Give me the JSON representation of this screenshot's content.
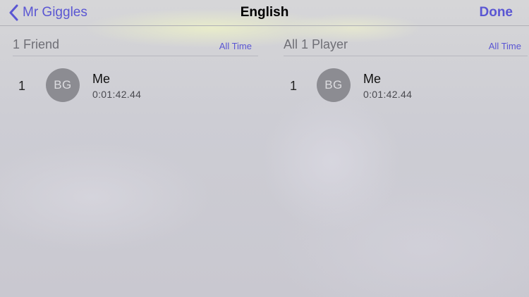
{
  "navbar": {
    "back_label": "Mr Giggles",
    "title": "English",
    "done_label": "Done"
  },
  "friends_panel": {
    "title": "1 Friend",
    "scope": "All Time",
    "entries": [
      {
        "rank": "1",
        "avatar_initials": "BG",
        "name": "Me",
        "score": "0:01:42.44"
      }
    ]
  },
  "players_panel": {
    "title": "All 1 Player",
    "scope": "All Time",
    "entries": [
      {
        "rank": "1",
        "avatar_initials": "BG",
        "name": "Me",
        "score": "0:01:42.44"
      }
    ]
  },
  "colors": {
    "accent": "#5a56d3",
    "avatar": "#8c8c92",
    "background": "#cfced6"
  }
}
